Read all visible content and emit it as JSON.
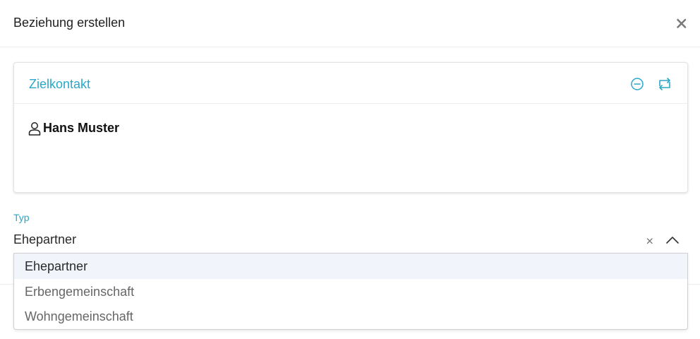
{
  "modal": {
    "title": "Beziehung erstellen",
    "close_icon": "close-icon"
  },
  "target_card": {
    "title": "Zielkontakt",
    "remove_icon": "minus-circle-icon",
    "swap_icon": "repeat-icon",
    "contact": {
      "icon": "user-icon",
      "name": "Hans Muster"
    }
  },
  "type_field": {
    "label": "Typ",
    "value": "Ehepartner",
    "clear_icon": "clear-icon",
    "toggle_icon": "chevron-up-icon",
    "options": [
      "Ehepartner",
      "Erbengemeinschaft",
      "Wohngemeinschaft"
    ],
    "selected_index": 0
  },
  "colors": {
    "accent": "#2aa7c9",
    "option_highlight": "#f1f5fb"
  }
}
